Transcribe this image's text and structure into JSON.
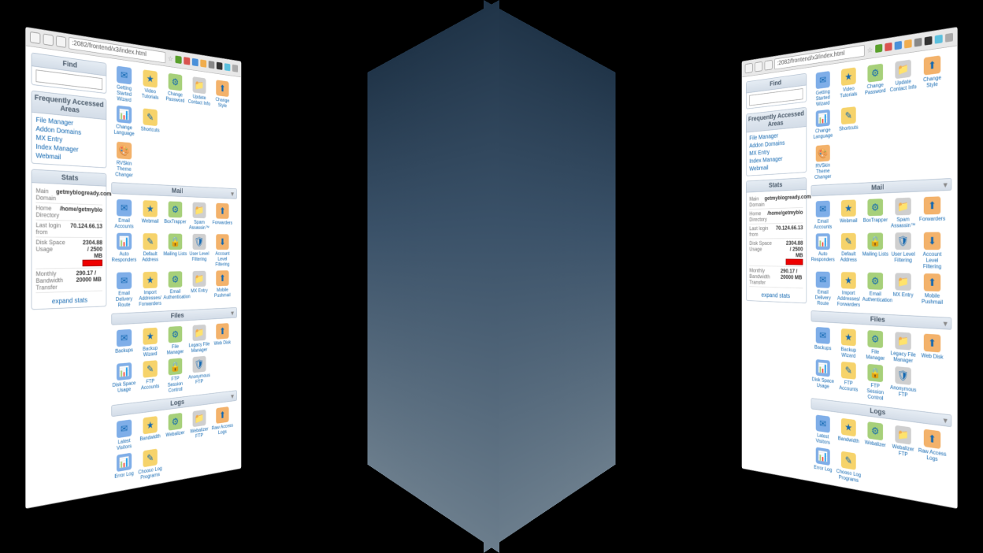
{
  "url": ":2082/frontend/x3/index.html",
  "find_title": "Find",
  "freq_title": "Frequently Accessed Areas",
  "freq_links": [
    "File Manager",
    "Addon Domains",
    "MX Entry",
    "Index Manager",
    "Webmail"
  ],
  "stats_title": "Stats",
  "stats": {
    "main_domain_k": "Main Domain",
    "main_domain_v": "getmyblogready.com",
    "home_k": "Home Directory",
    "home_v": "/home/getmyblo",
    "last_k": "Last login from",
    "last_v": "70.124.66.13",
    "disk_k": "Disk Space Usage",
    "disk_v": "2304.88 / 2500 MB",
    "bw_k": "Monthly Bandwidth Transfer",
    "bw_v": "290.17 / 20000 MB"
  },
  "expand": "expand stats",
  "top_tools": [
    "Getting Started Wizard",
    "Video Tutorials",
    "Change Password",
    "Update Contact Info",
    "Change Style",
    "Change Language",
    "Shortcuts"
  ],
  "rvskin": "RVSkin Theme Changer",
  "mail_title": "Mail",
  "mail_tools": [
    "Email Accounts",
    "Webmail",
    "BoxTrapper",
    "Spam Assassin™",
    "Forwarders",
    "Auto Responders",
    "Default Address",
    "Mailing Lists",
    "User Level Filtering",
    "Account Level Filtering",
    "Email Delivery Route",
    "Import Addresses/ Forwarders",
    "Email Authentication",
    "MX Entry",
    "Mobile Pushmail"
  ],
  "files_title": "Files",
  "files_tools": [
    "Backups",
    "Backup Wizard",
    "File Manager",
    "Legacy File Manager",
    "Web Disk",
    "Disk Space Usage",
    "FTP Accounts",
    "FTP Session Control",
    "Anonymous FTP"
  ],
  "logs_title": "Logs",
  "logs_tools": [
    "Latest Visitors",
    "Bandwidth",
    "Webalizer",
    "Webalizer FTP",
    "Raw Access Logs",
    "Error Log",
    "Choose Log Programs"
  ]
}
